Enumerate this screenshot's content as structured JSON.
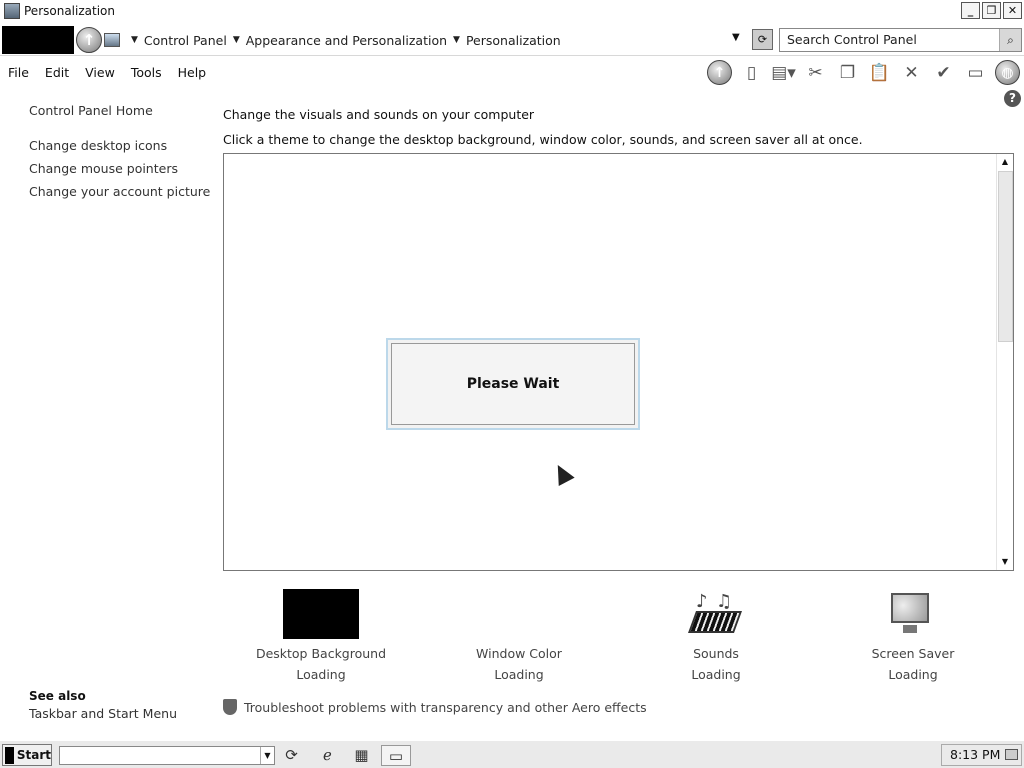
{
  "window": {
    "title": "Personalization"
  },
  "addressbar": {
    "crumbs": [
      "Control Panel",
      "Appearance and Personalization",
      "Personalization"
    ],
    "search_placeholder": "Search Control Panel"
  },
  "menu": [
    "File",
    "Edit",
    "View",
    "Tools",
    "Help"
  ],
  "left_pane": {
    "home": "Control Panel Home",
    "tasks": [
      "Change desktop icons",
      "Change mouse pointers",
      "Change your account picture"
    ],
    "see_also_title": "See also",
    "see_also_links": [
      "Taskbar and Start Menu"
    ]
  },
  "main": {
    "heading": "Change the visuals and sounds on your computer",
    "subheading": "Click a theme to change the desktop background, window color, sounds, and screen saver all at once.",
    "wait_text": "Please Wait",
    "options": [
      {
        "label": "Desktop Background",
        "status": "Loading"
      },
      {
        "label": "Window Color",
        "status": "Loading"
      },
      {
        "label": "Sounds",
        "status": "Loading"
      },
      {
        "label": "Screen Saver",
        "status": "Loading"
      }
    ],
    "troubleshoot": "Troubleshoot problems with transparency and other Aero effects"
  },
  "taskbar": {
    "start_label": "Start",
    "clock": "8:13 PM"
  }
}
